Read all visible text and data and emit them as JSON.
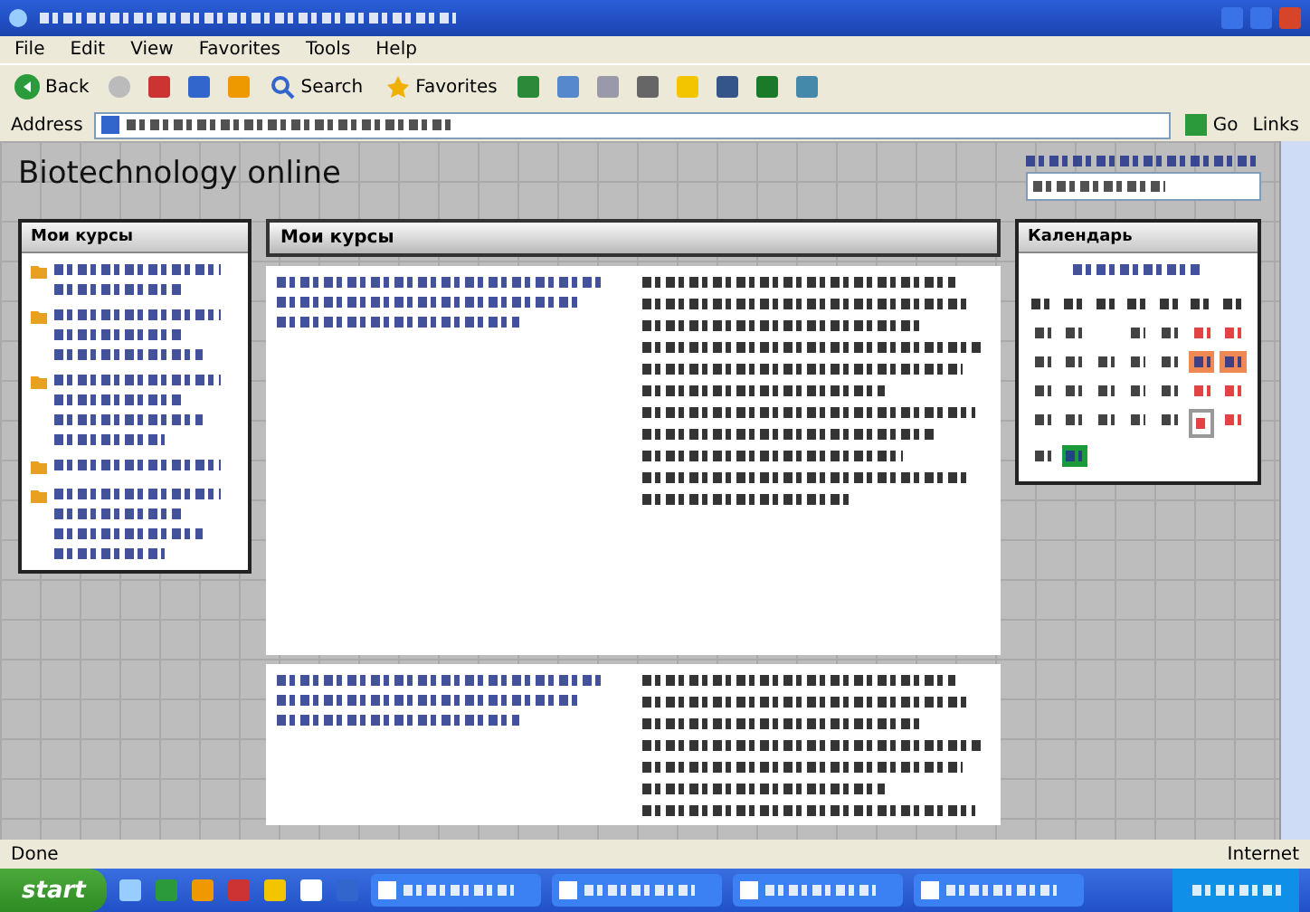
{
  "menu": [
    "File",
    "Edit",
    "View",
    "Favorites",
    "Tools",
    "Help"
  ],
  "toolbar": {
    "back": "Back",
    "search": "Search",
    "favorites": "Favorites"
  },
  "address": {
    "label": "Address",
    "go": "Go",
    "links": "Links"
  },
  "page": {
    "site_title": "Biotechnology online"
  },
  "left_block": {
    "title": "Мои курсы"
  },
  "center": {
    "title": "Мои курсы"
  },
  "calendar": {
    "title": "Календарь",
    "cells": [
      {
        "kind": "day"
      },
      {
        "kind": "day"
      },
      {
        "kind": "blank"
      },
      {
        "kind": "day"
      },
      {
        "kind": "day"
      },
      {
        "kind": "weekend"
      },
      {
        "kind": "weekend"
      },
      {
        "kind": "day"
      },
      {
        "kind": "day"
      },
      {
        "kind": "day"
      },
      {
        "kind": "day"
      },
      {
        "kind": "day"
      },
      {
        "kind": "event"
      },
      {
        "kind": "event"
      },
      {
        "kind": "day"
      },
      {
        "kind": "day"
      },
      {
        "kind": "day"
      },
      {
        "kind": "day"
      },
      {
        "kind": "day"
      },
      {
        "kind": "weekend"
      },
      {
        "kind": "weekend"
      },
      {
        "kind": "day"
      },
      {
        "kind": "day"
      },
      {
        "kind": "day"
      },
      {
        "kind": "day"
      },
      {
        "kind": "day"
      },
      {
        "kind": "today"
      },
      {
        "kind": "weekend"
      },
      {
        "kind": "day"
      },
      {
        "kind": "selected"
      }
    ]
  },
  "status_bar": {
    "text": "Done",
    "zone": "Internet"
  },
  "taskbar": {
    "start": "start"
  }
}
